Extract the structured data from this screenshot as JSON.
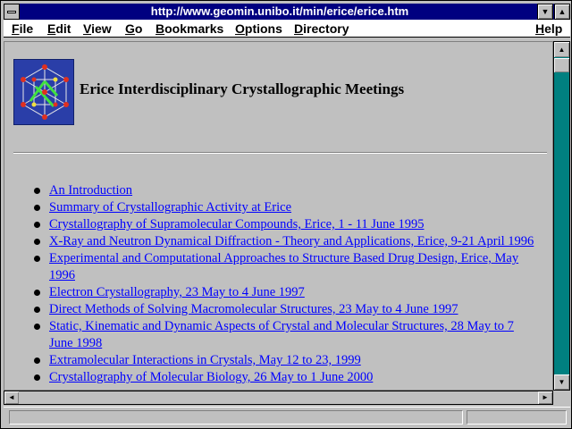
{
  "window": {
    "title": "http://www.geomin.unibo.it/min/erice/erice.htm",
    "minimize_glyph": "▼",
    "maximize_glyph": "▲"
  },
  "menu": [
    {
      "first": "F",
      "rest": "ile"
    },
    {
      "first": "E",
      "rest": "dit"
    },
    {
      "first": "V",
      "rest": "iew"
    },
    {
      "first": "G",
      "rest": "o"
    },
    {
      "first": "B",
      "rest": "ookmarks"
    },
    {
      "first": "O",
      "rest": "ptions"
    },
    {
      "first": "D",
      "rest": "irectory"
    },
    {
      "first": "H",
      "rest": "elp"
    }
  ],
  "page": {
    "logo_icon": "crystal-lattice-icon",
    "title": "Erice Interdisciplinary Crystallographic Meetings",
    "links": [
      "An Introduction",
      "Summary of Crystallographic Activity at Erice",
      "Crystallography of Supramolecular Compounds, Erice, 1 - 11 June 1995",
      "X-Ray and Neutron Dynamical Diffraction - Theory and Applications, Erice, 9-21 April 1996",
      "Experimental and Computational Approaches to Structure Based Drug Design, Erice, May 1996",
      "Electron Crystallography, 23 May to 4 June 1997",
      "Direct Methods of Solving Macromolecular Structures, 23 May to 4 June 1997",
      "Static, Kinematic and Dynamic Aspects of Crystal and Molecular Structures, 28 May to 7 June 1998",
      "Extramolecular Interactions in Crystals, May 12 to 23, 1999",
      "Crystallography of Molecular Biology, 26 May to 1 June 2000"
    ]
  },
  "scrollbars": {
    "up_glyph": "▲",
    "down_glyph": "▼",
    "left_glyph": "◄",
    "right_glyph": "►"
  },
  "status": {
    "text": ""
  },
  "colors": {
    "titlebar": "#000080",
    "link": "#0000ff",
    "background": "#c0c0c0",
    "scroll_track": "#008080"
  }
}
